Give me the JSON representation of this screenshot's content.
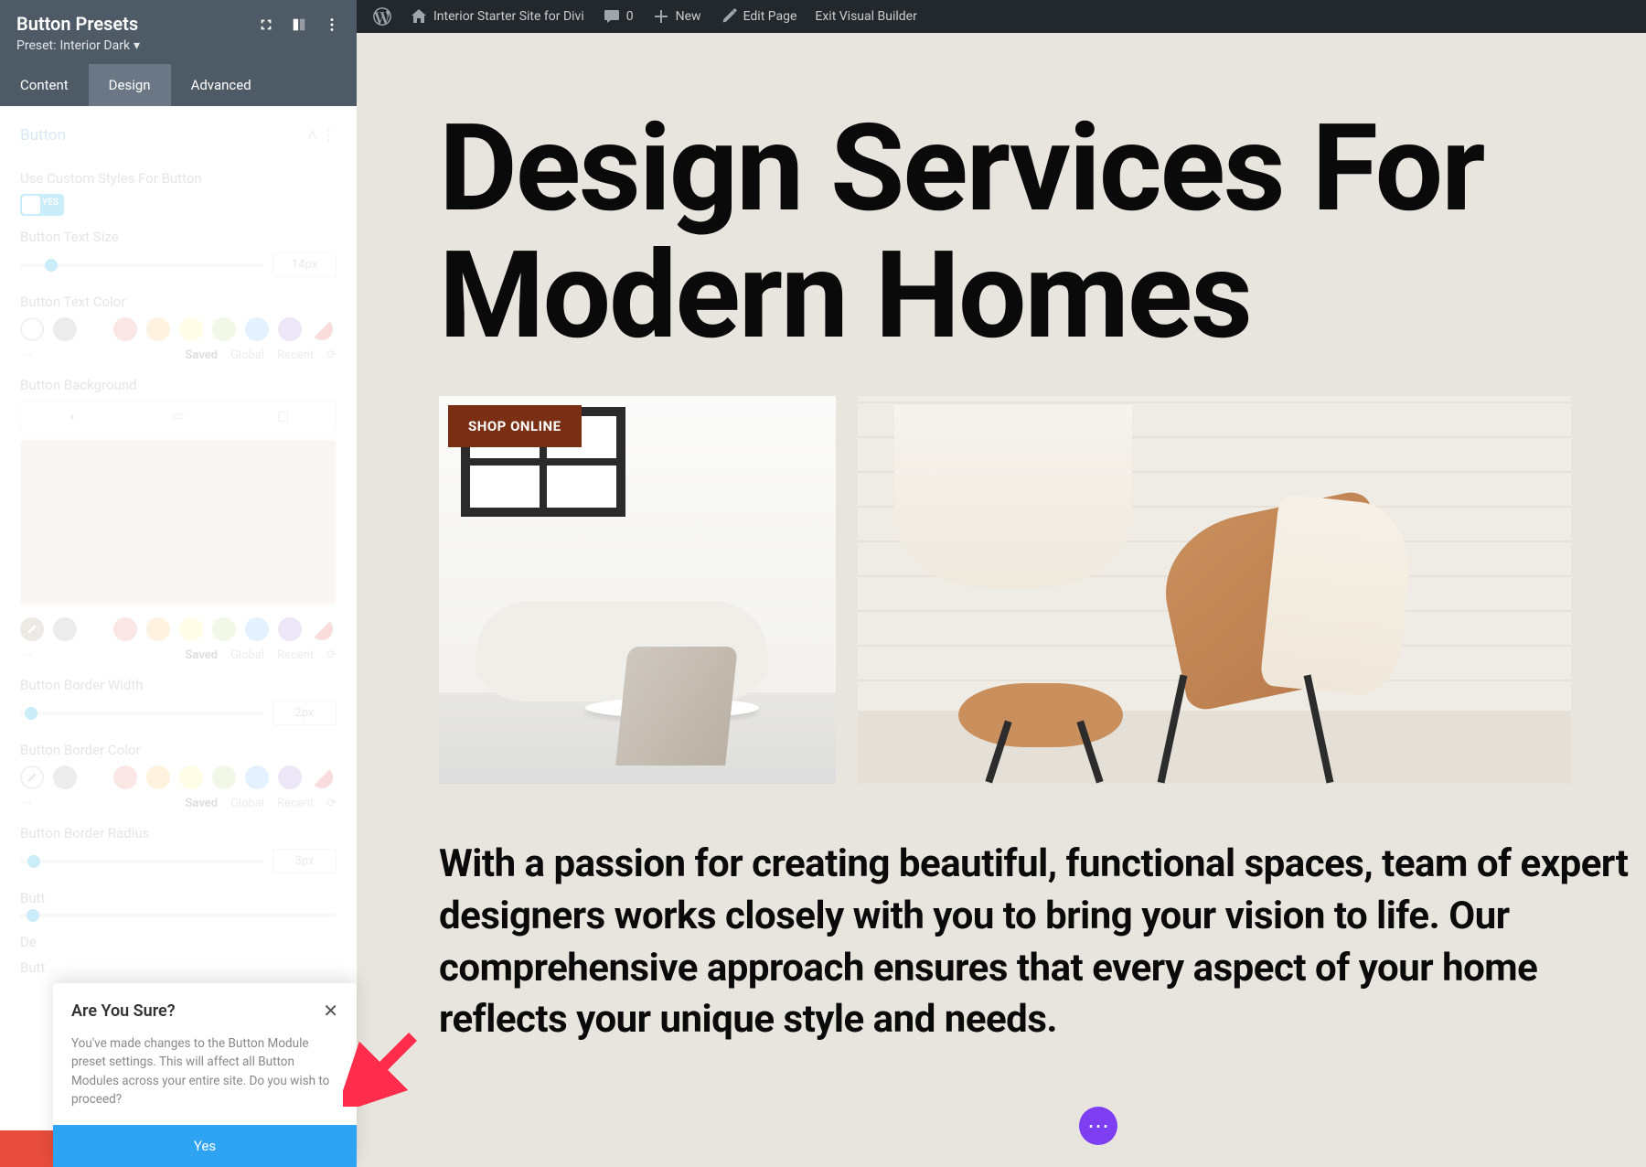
{
  "admin_bar": {
    "site_name": "Interior Starter Site for Divi",
    "comments": "0",
    "new": "New",
    "edit_page": "Edit Page",
    "exit_vb": "Exit Visual Builder"
  },
  "sidebar": {
    "title": "Button Presets",
    "preset_label": "Preset:",
    "preset_value": "Interior Dark",
    "tabs": {
      "content": "Content",
      "design": "Design",
      "advanced": "Advanced"
    },
    "section": "Button",
    "use_custom_label": "Use Custom Styles For Button",
    "toggle_yes": "YES",
    "text_size_label": "Button Text Size",
    "text_size_value": "14px",
    "text_color_label": "Button Text Color",
    "meta": {
      "saved": "Saved",
      "global": "Global",
      "recent": "Recent"
    },
    "bg_label": "Button Background",
    "border_width_label": "Button Border Width",
    "border_width_value": "2px",
    "border_color_label": "Button Border Color",
    "border_radius_label": "Button Border Radius",
    "border_radius_value": "3px",
    "hidden_label_1": "Butt",
    "hidden_label_2": "De",
    "hidden_label_3": "Butt"
  },
  "confirm": {
    "title": "Are You Sure?",
    "body": "You've made changes to the Button Module preset settings. This will affect all Button Modules across your entire site. Do you wish to proceed?",
    "yes": "Yes"
  },
  "page": {
    "hero": "Design Services For Modern Homes",
    "shop_btn": "SHOP ONLINE",
    "body": "With a passion for creating beautiful, functional spaces, team of expert designers works closely with you to bring your vision to life. Our comprehensive approach ensures that every aspect of your home reflects your unique style and needs."
  }
}
